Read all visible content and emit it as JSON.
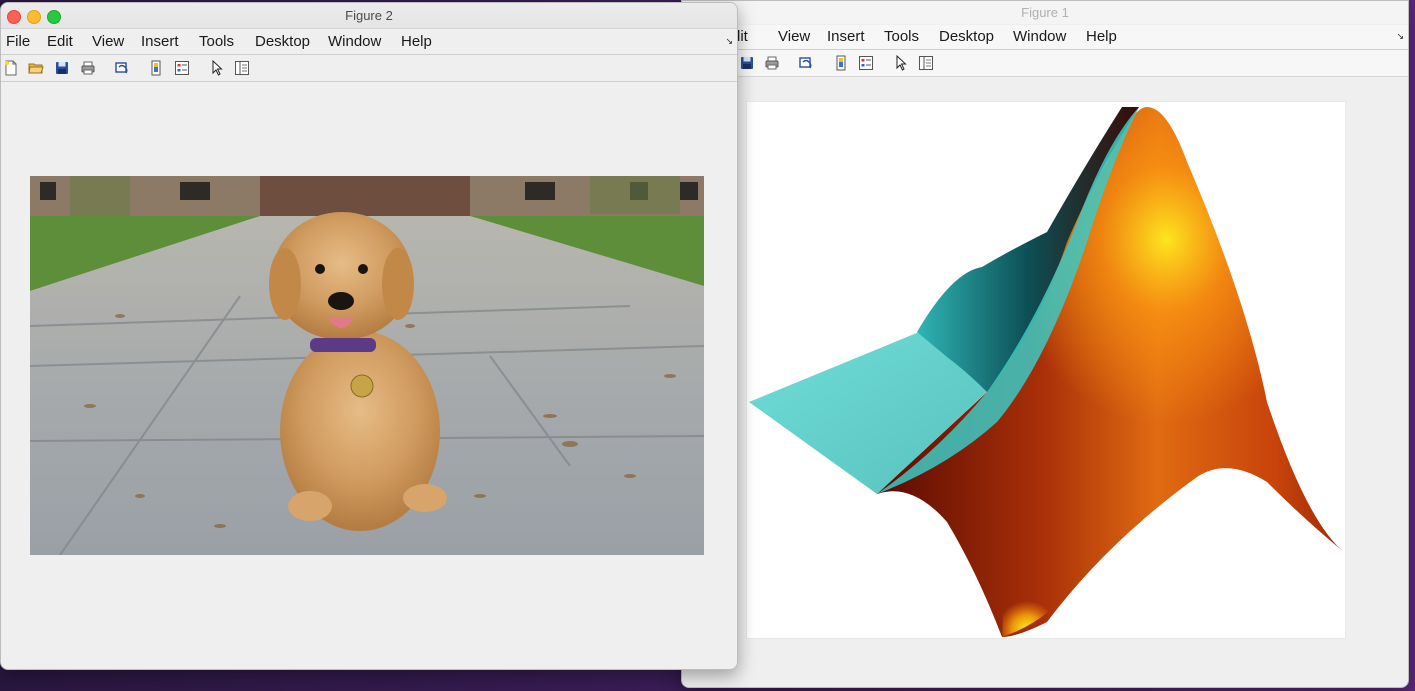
{
  "figure2": {
    "title": "Figure 2",
    "menus": [
      "File",
      "Edit",
      "View",
      "Insert",
      "Tools",
      "Desktop",
      "Window",
      "Help"
    ],
    "toolbar_icons": [
      "new-figure-icon",
      "open-file-icon",
      "save-icon",
      "print-icon",
      "link-plot-icon",
      "insert-colorbar-icon",
      "insert-legend-icon",
      "edit-plot-icon",
      "property-inspector-icon"
    ],
    "image": "puppy-photo"
  },
  "figure1": {
    "title": "Figure 1",
    "menus": [
      "Edit",
      "View",
      "Insert",
      "Tools",
      "Desktop",
      "Window",
      "Help"
    ],
    "menu_first_partial": "dit",
    "toolbar_icons": [
      "save-icon",
      "print-icon",
      "link-plot-icon",
      "insert-colorbar-icon",
      "insert-legend-icon",
      "edit-plot-icon",
      "property-inspector-icon"
    ],
    "plot": "matlab-membrane-surface",
    "colors": {
      "surface_dark": "#7a1a06",
      "surface_mid": "#d9530d",
      "surface_bright": "#ffe50a",
      "surface_cyan": "#5fd6d2"
    }
  }
}
